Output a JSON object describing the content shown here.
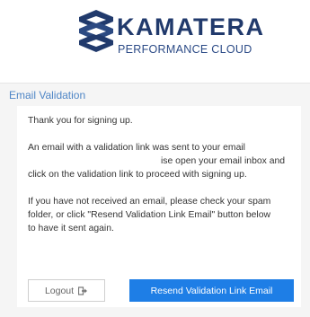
{
  "brand": {
    "name": "KAMATERA",
    "tagline": "PERFORMANCE CLOUD",
    "logo_icon": "kamatera-logo-icon",
    "primary_color": "#213a6c"
  },
  "panel": {
    "title": "Email Validation",
    "title_color": "#4f86c6"
  },
  "message": {
    "line1": "Thank you for signing up.",
    "line2": "An email with a validation link was sent to your email",
    "line3_visible": "ise open your email inbox and",
    "line4": "click on the validation link to proceed with signing up.",
    "line5": "If you have not received an email, please check your spam",
    "line6": "folder, or click \"Resend Validation Link Email\" button below",
    "line7": "to have it sent again."
  },
  "buttons": {
    "logout_label": "Logout",
    "logout_icon": "sign-out-icon",
    "resend_label": "Resend Validation Link Email",
    "resend_color": "#1e7ee6"
  }
}
